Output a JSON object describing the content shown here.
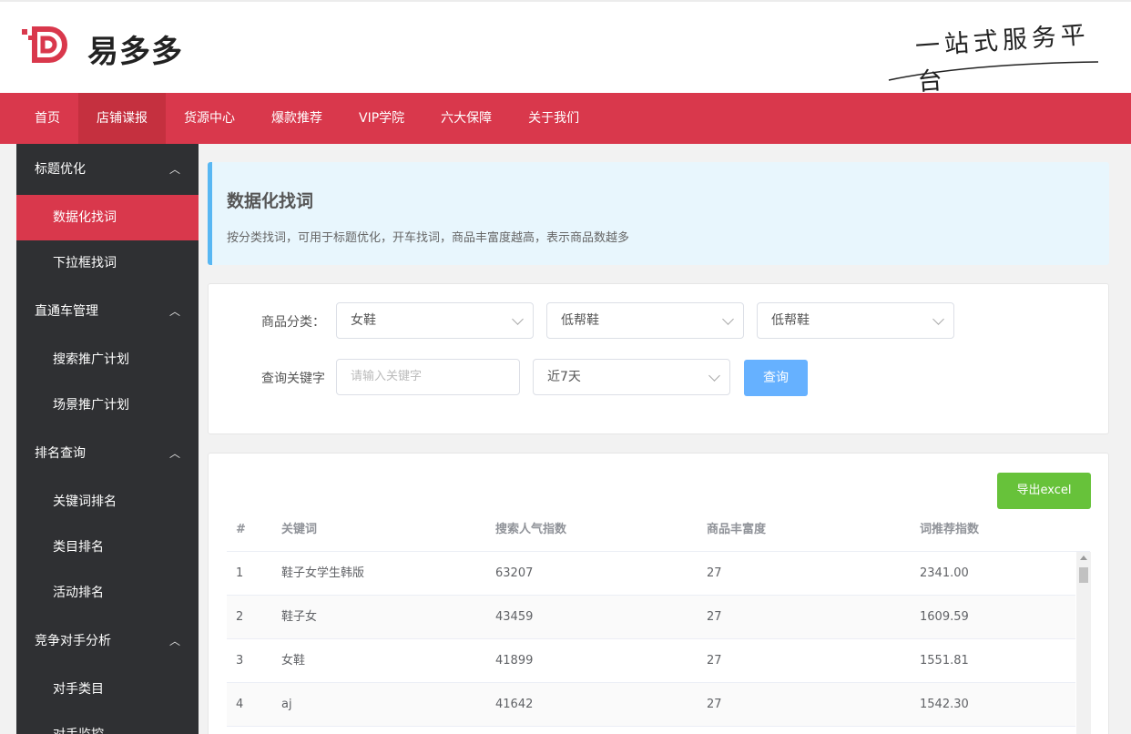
{
  "brand": {
    "name": "易多多",
    "slogan": "一站式服务平台"
  },
  "nav": [
    "首页",
    "店铺谍报",
    "货源中心",
    "爆款推荐",
    "VIP学院",
    "六大保障",
    "关于我们"
  ],
  "sidebar": {
    "groups": [
      {
        "label": "标题优化",
        "items": [
          "数据化找词",
          "下拉框找词"
        ]
      },
      {
        "label": "直通车管理",
        "items": [
          "搜索推广计划",
          "场景推广计划"
        ]
      },
      {
        "label": "排名查询",
        "items": [
          "关键词排名",
          "类目排名",
          "活动排名"
        ]
      },
      {
        "label": "竞争对手分析",
        "items": [
          "对手类目",
          "对手监控"
        ]
      }
    ]
  },
  "info": {
    "title": "数据化找词",
    "desc": "按分类找词，可用于标题优化，开车找词，商品丰富度越高，表示商品数越多"
  },
  "filters": {
    "category_label": "商品分类：",
    "category1": "女鞋",
    "category2": "低帮鞋",
    "category3": "低帮鞋",
    "keyword_label": "查询关键字",
    "keyword_placeholder": "请输入关键字",
    "period": "近7天",
    "query_btn": "查询"
  },
  "table": {
    "export_btn": "导出excel",
    "headers": [
      "#",
      "关键词",
      "搜索人气指数",
      "商品丰富度",
      "词推荐指数"
    ],
    "rows": [
      [
        "1",
        "鞋子女学生韩版",
        "63207",
        "27",
        "2341.00"
      ],
      [
        "2",
        "鞋子女",
        "43459",
        "27",
        "1609.59"
      ],
      [
        "3",
        "女鞋",
        "41899",
        "27",
        "1551.81"
      ],
      [
        "4",
        "aj",
        "41642",
        "27",
        "1542.30"
      ]
    ]
  },
  "colors": {
    "accent": "#d9384c",
    "info_border": "#58b7f3",
    "export": "#67c23a",
    "query": "#66b1ff"
  }
}
